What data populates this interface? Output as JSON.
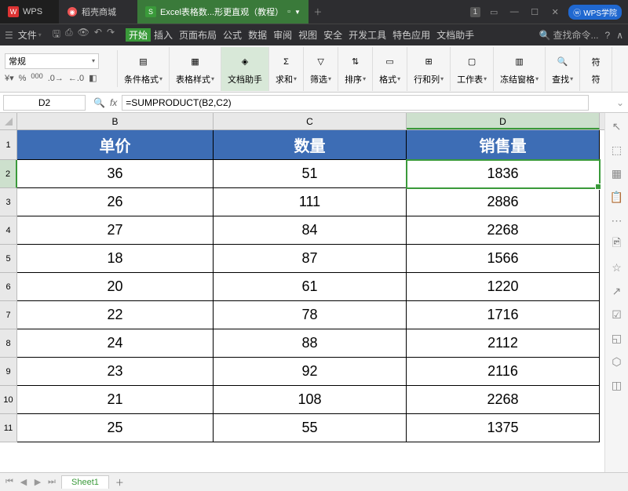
{
  "titlebar": {
    "wps": "WPS",
    "store": "稻壳商城",
    "active_tab": "Excel表格数...形更直观（教程）",
    "badge": "1",
    "academy": "WPS学院"
  },
  "menubar": {
    "file": "文件",
    "tabs": [
      "开始",
      "插入",
      "页面布局",
      "公式",
      "数据",
      "审阅",
      "视图",
      "安全",
      "开发工具",
      "特色应用",
      "文档助手"
    ],
    "search_placeholder": "查找命令...",
    "help": "?"
  },
  "ribbon": {
    "format_label": "常规",
    "btns": [
      {
        "label": "条件格式",
        "icon": "cond"
      },
      {
        "label": "表格样式",
        "icon": "tblstyle"
      },
      {
        "label": "文档助手",
        "icon": "docassist",
        "active": true,
        "nodrop": true
      },
      {
        "label": "求和",
        "icon": "sum"
      },
      {
        "label": "筛选",
        "icon": "filter"
      },
      {
        "label": "排序",
        "icon": "sort"
      },
      {
        "label": "格式",
        "icon": "fmt"
      },
      {
        "label": "行和列",
        "icon": "rowcol"
      },
      {
        "label": "工作表",
        "icon": "ws"
      },
      {
        "label": "冻结窗格",
        "icon": "freeze"
      },
      {
        "label": "查找",
        "icon": "find"
      },
      {
        "label": "符",
        "icon": "sym",
        "nodrop": true
      }
    ]
  },
  "formula": {
    "cell_ref": "D2",
    "formula": "=SUMPRODUCT(B2,C2)"
  },
  "columns": [
    "B",
    "C",
    "D"
  ],
  "headers": [
    "单价",
    "数量",
    "销售量"
  ],
  "rows": [
    {
      "n": 1
    },
    {
      "n": 2,
      "b": "36",
      "c": "51",
      "d": "1836",
      "sel": true
    },
    {
      "n": 3,
      "b": "26",
      "c": "111",
      "d": "2886"
    },
    {
      "n": 4,
      "b": "27",
      "c": "84",
      "d": "2268"
    },
    {
      "n": 5,
      "b": "18",
      "c": "87",
      "d": "1566"
    },
    {
      "n": 6,
      "b": "20",
      "c": "61",
      "d": "1220"
    },
    {
      "n": 7,
      "b": "22",
      "c": "78",
      "d": "1716"
    },
    {
      "n": 8,
      "b": "24",
      "c": "88",
      "d": "2112"
    },
    {
      "n": 9,
      "b": "23",
      "c": "92",
      "d": "2116"
    },
    {
      "n": 10,
      "b": "21",
      "c": "108",
      "d": "2268"
    },
    {
      "n": 11,
      "b": "25",
      "c": "55",
      "d": "1375"
    }
  ],
  "sheet": {
    "name": "Sheet1"
  }
}
